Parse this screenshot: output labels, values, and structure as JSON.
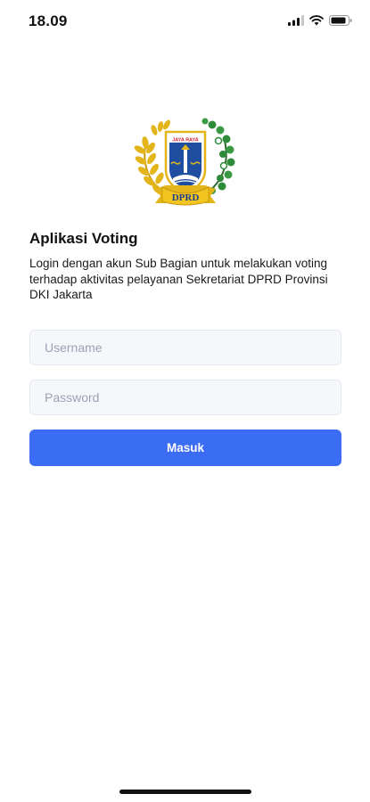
{
  "status_bar": {
    "time": "18.09",
    "icons": [
      "signal-icon",
      "wifi-icon",
      "battery-icon"
    ]
  },
  "logo": {
    "banner_text": "DPRD",
    "shield_text": "JAYA RAYA",
    "colors": {
      "gold": "#e3b51a",
      "green": "#2e8b3a",
      "shield_blue": "#1f4ea1",
      "shield_red": "#c8202f"
    }
  },
  "login": {
    "title": "Aplikasi Voting",
    "description": "Login dengan akun Sub Bagian untuk melakukan voting terhadap aktivitas pelayanan Sekretariat DPRD Provinsi DKI Jakarta",
    "username_placeholder": "Username",
    "password_placeholder": "Password",
    "submit_label": "Masuk"
  },
  "colors": {
    "accent": "#3a6cf4",
    "input_background": "#f6f7fb",
    "input_border": "#e5e8ef"
  }
}
